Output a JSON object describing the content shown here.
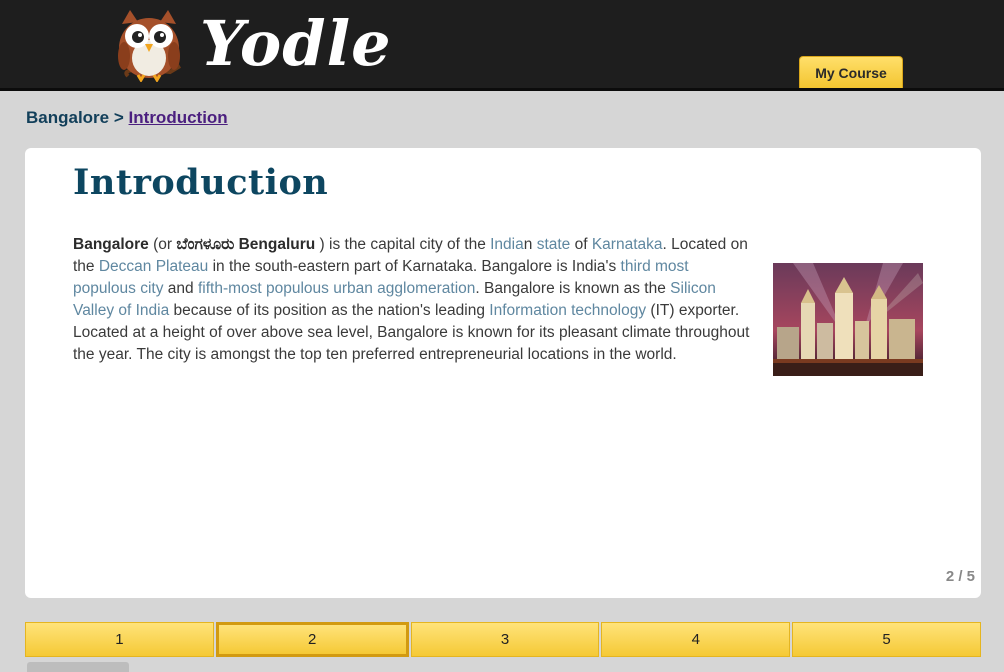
{
  "header": {
    "logo_text": "Yodle",
    "my_course_label": "My Course"
  },
  "breadcrumb": {
    "parent": "Bangalore",
    "separator": ">",
    "current": "Introduction"
  },
  "article": {
    "title": "Introduction",
    "body": {
      "t1": "Bangalore",
      "t2": " (or ",
      "t3": "ಬೆಂಗಳೂರು",
      "t4": " Bengaluru",
      "t5": " ) is the capital city of the ",
      "l1": "India",
      "t6": "n ",
      "l2": "state",
      "t7": " of ",
      "l3": "Karnataka",
      "t8": ". Located on the ",
      "l4": "Deccan Plateau",
      "t9": " in the south-eastern part of Karnataka. Bangalore is India's ",
      "l5": "third most populous city",
      "t10": " and ",
      "l6": "fifth-most populous urban agglomeration",
      "t11": ". Bangalore is known as the ",
      "l7": "Silicon Valley of India",
      "t12": " because of its position as the nation's leading ",
      "l8": "Information technology",
      "t13": " (IT) exporter. Located at a height of over above sea level, Bangalore is known for its pleasant climate throughout the year. The city is amongst the top ten preferred entrepreneurial locations in the world."
    },
    "page_indicator": "2 / 5"
  },
  "pager": {
    "pages": [
      "1",
      "2",
      "3",
      "4",
      "5"
    ],
    "active_page": "2"
  },
  "colors": {
    "header_bg": "#1e1e1e",
    "accent_yellow": "#f5c935",
    "title_blue": "#0d4660",
    "link_blue": "#5f87a0",
    "breadcrumb_link": "#4b1f7f"
  }
}
